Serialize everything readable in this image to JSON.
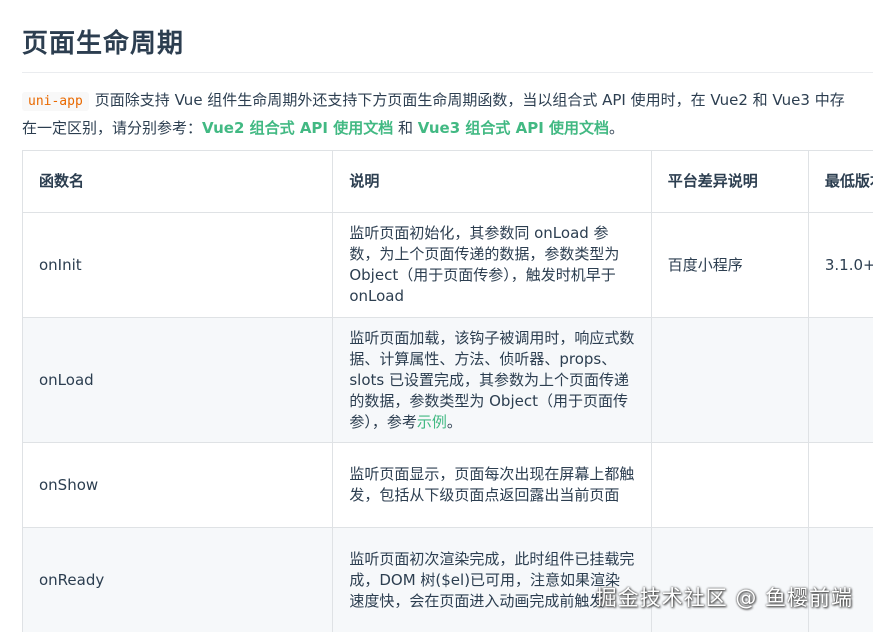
{
  "page_title": "页面生命周期",
  "intro": {
    "code_tag": "uni-app",
    "line1_text": "页面除支持 Vue 组件生命周期外还支持下方页面生命周期函数，当以组合式 API 使用时，在 Vue2 和 Vue3 中存",
    "line2_prefix": "在一定区别，请分别参考：",
    "link1": "Vue2 组合式 API 使用文档",
    "and_text": " 和 ",
    "link2": "Vue3 组合式 API 使用文档",
    "line2_suffix": "。"
  },
  "table": {
    "headers": [
      "函数名",
      "说明",
      "平台差异说明",
      "最低版本"
    ],
    "rows": [
      {
        "name": "onInit",
        "desc": "监听页面初始化，其参数同 onLoad 参数，为上个页面传递的数据，参数类型为 Object（用于页面传参），触发时机早于 onLoad",
        "platform": "百度小程序",
        "version": "3.1.0+"
      },
      {
        "name": "onLoad",
        "desc": "监听页面加载，该钩子被调用时，响应式数据、计算属性、方法、侦听器、props、slots 已设置完成，其参数为上个页面传递的数据，参数类型为 Object（用于页面传参），参考",
        "desc_link": "示例",
        "desc_suffix": "。",
        "platform": "",
        "version": ""
      },
      {
        "name": "onShow",
        "desc": "监听页面显示，页面每次出现在屏幕上都触发，包括从下级页面点返回露出当前页面",
        "platform": "",
        "version": ""
      },
      {
        "name": "onReady",
        "desc": "监听页面初次渲染完成，此时组件已挂载完成，DOM 树($el)已可用，注意如果渲染速度快，会在页面进入动画完成前触发",
        "platform": "",
        "version": ""
      }
    ]
  },
  "watermark": "掘金技术社区 @ 鱼樱前端",
  "colors": {
    "text": "#2c3e50",
    "link": "#42b983",
    "code": "#e96900",
    "border": "#dfe2e5",
    "alt_row": "#f6f8fa"
  }
}
